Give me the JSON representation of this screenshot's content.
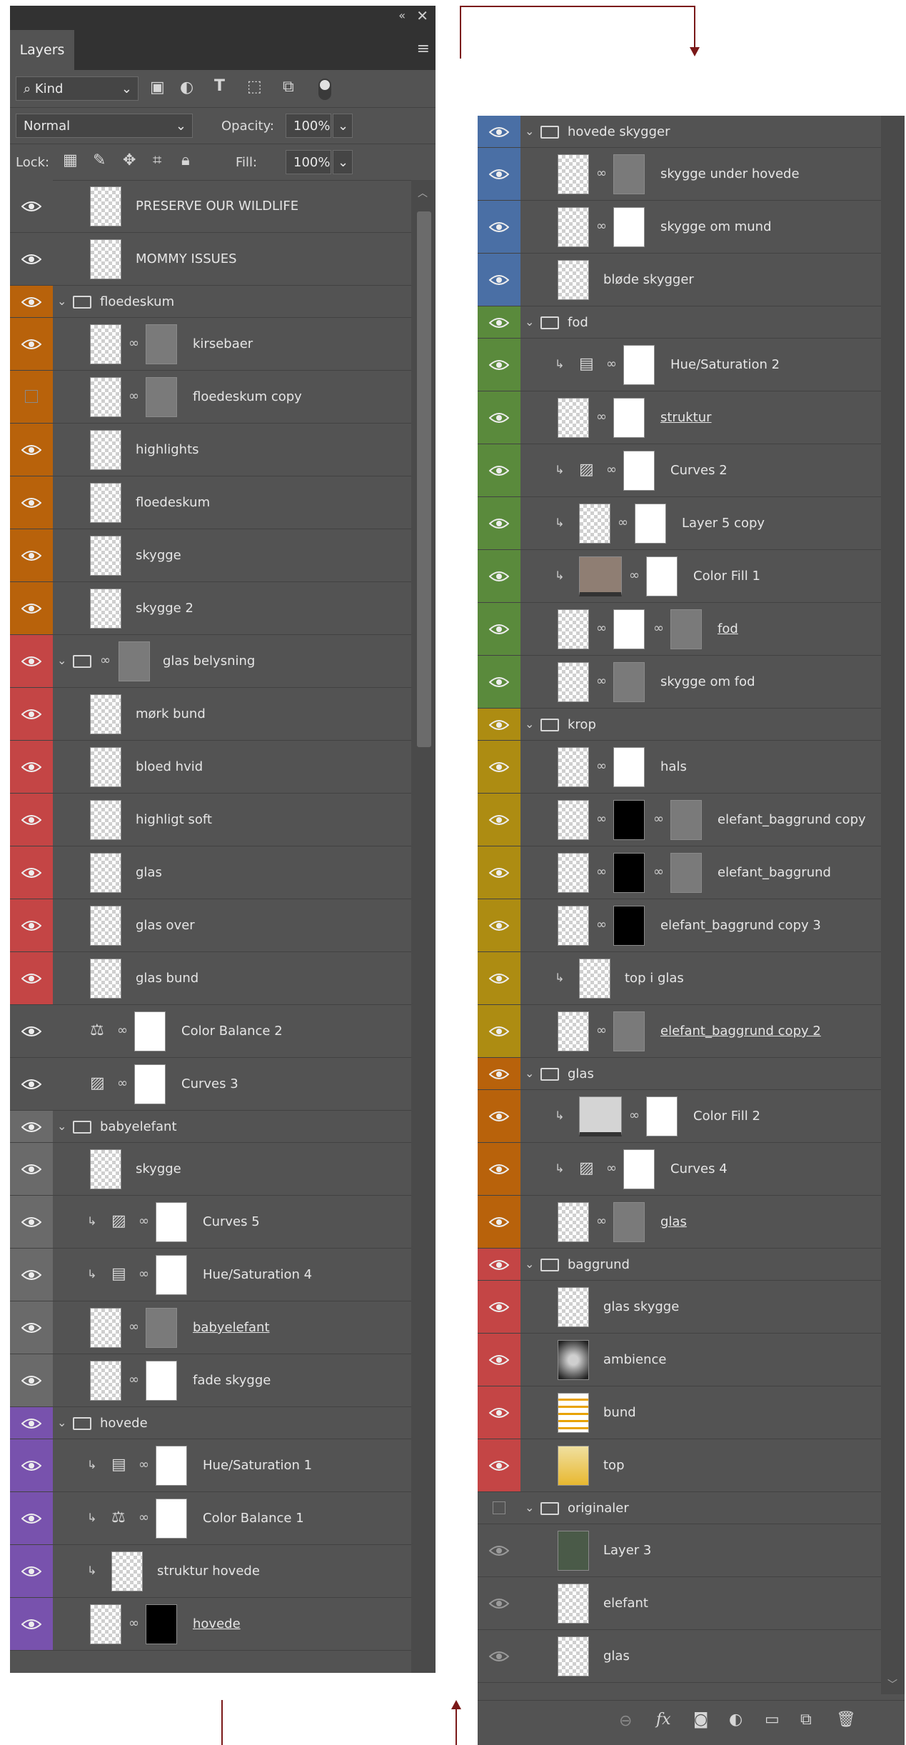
{
  "panel": {
    "tab_label": "Layers",
    "filter_kind": "Kind",
    "blend_mode": "Normal",
    "opacity_label": "Opacity:",
    "opacity_value": "100%",
    "lock_label": "Lock:",
    "fill_label": "Fill:",
    "fill_value": "100%"
  },
  "colors": {
    "orange": "#b8620b",
    "red": "#c44545",
    "gray": "#6a6a6a",
    "purple": "#7852ad",
    "blue": "#4a6fa5",
    "green": "#5a8a3c",
    "yellow": "#ad8c12",
    "none": "#535353"
  },
  "left_layers": [
    {
      "name": "PRESERVE OUR WILDLIFE",
      "type": "layer",
      "color": "none",
      "visible": true,
      "thumb": "checker"
    },
    {
      "name": "MOMMY ISSUES",
      "type": "layer",
      "color": "none",
      "visible": true,
      "thumb": "checker"
    },
    {
      "name": "floedeskum",
      "type": "group",
      "color": "orange",
      "visible": true
    },
    {
      "name": "kirsebaer",
      "type": "layer",
      "color": "orange",
      "visible": true,
      "thumb": "checker",
      "mask": "gray"
    },
    {
      "name": "floedeskum copy",
      "type": "layer",
      "color": "orange",
      "visible": false,
      "thumb": "checker",
      "mask": "gray"
    },
    {
      "name": "highlights",
      "type": "layer",
      "color": "orange",
      "visible": true,
      "thumb": "checker"
    },
    {
      "name": "floedeskum",
      "type": "layer",
      "color": "orange",
      "visible": true,
      "thumb": "checker"
    },
    {
      "name": "skygge",
      "type": "layer",
      "color": "orange",
      "visible": true,
      "thumb": "checker"
    },
    {
      "name": "skygge 2",
      "type": "layer",
      "color": "orange",
      "visible": true,
      "thumb": "checker"
    },
    {
      "name": "glas belysning",
      "type": "group",
      "color": "red",
      "visible": true,
      "mask": "gray",
      "tall": true
    },
    {
      "name": "mørk bund",
      "type": "layer",
      "color": "red",
      "visible": true,
      "thumb": "checker"
    },
    {
      "name": "bloed hvid",
      "type": "layer",
      "color": "red",
      "visible": true,
      "thumb": "checker"
    },
    {
      "name": "highligt soft",
      "type": "layer",
      "color": "red",
      "visible": true,
      "thumb": "checker"
    },
    {
      "name": "glas",
      "type": "layer",
      "color": "red",
      "visible": true,
      "thumb": "checker"
    },
    {
      "name": "glas over",
      "type": "layer",
      "color": "red",
      "visible": true,
      "thumb": "checker"
    },
    {
      "name": "glas bund",
      "type": "layer",
      "color": "red",
      "visible": true,
      "thumb": "checker"
    },
    {
      "name": "Color Balance 2",
      "type": "adjust",
      "icon": "balance",
      "color": "none",
      "visible": true,
      "mask": "white"
    },
    {
      "name": "Curves 3",
      "type": "adjust",
      "icon": "curves",
      "color": "none",
      "visible": true,
      "mask": "white"
    },
    {
      "name": "babyelefant",
      "type": "group",
      "color": "gray",
      "visible": true
    },
    {
      "name": "skygge",
      "type": "layer",
      "color": "gray",
      "visible": true,
      "thumb": "checker"
    },
    {
      "name": "Curves 5",
      "type": "adjust",
      "icon": "curves",
      "color": "gray",
      "visible": true,
      "mask": "white",
      "clip": true
    },
    {
      "name": "Hue/Saturation 4",
      "type": "adjust",
      "icon": "huesat",
      "color": "gray",
      "visible": true,
      "mask": "white",
      "clip": true
    },
    {
      "name": "babyelefant",
      "type": "layer",
      "color": "gray",
      "visible": true,
      "thumb": "checker",
      "mask": "gray",
      "smart": true
    },
    {
      "name": "fade skygge",
      "type": "layer",
      "color": "gray",
      "visible": true,
      "thumb": "checker",
      "mask": "white"
    },
    {
      "name": "hovede",
      "type": "group",
      "color": "purple",
      "visible": true
    },
    {
      "name": "Hue/Saturation 1",
      "type": "adjust",
      "icon": "huesat",
      "color": "purple",
      "visible": true,
      "mask": "white",
      "clip": true
    },
    {
      "name": "Color Balance 1",
      "type": "adjust",
      "icon": "balance",
      "color": "purple",
      "visible": true,
      "mask": "white",
      "clip": true
    },
    {
      "name": "struktur hovede",
      "type": "layer",
      "color": "purple",
      "visible": true,
      "thumb": "checker",
      "clip": true
    },
    {
      "name": "hovede",
      "type": "layer",
      "color": "purple",
      "visible": true,
      "thumb": "checker",
      "mask": "black",
      "smart": true
    }
  ],
  "right_layers": [
    {
      "name": "hovede skygger",
      "type": "group",
      "color": "blue",
      "visible": true
    },
    {
      "name": "skygge under hovede",
      "type": "layer",
      "color": "blue",
      "visible": true,
      "thumb": "checker",
      "mask": "gray"
    },
    {
      "name": "skygge om mund",
      "type": "layer",
      "color": "blue",
      "visible": true,
      "thumb": "checker",
      "mask": "white"
    },
    {
      "name": "bløde skygger",
      "type": "layer",
      "color": "blue",
      "visible": true,
      "thumb": "checker"
    },
    {
      "name": "fod",
      "type": "group",
      "color": "green",
      "visible": true
    },
    {
      "name": "Hue/Saturation 2",
      "type": "adjust",
      "icon": "huesat",
      "color": "green",
      "visible": true,
      "mask": "white",
      "clip": true
    },
    {
      "name": "struktur",
      "type": "layer",
      "color": "green",
      "visible": true,
      "thumb": "checker",
      "mask": "white",
      "smart": true
    },
    {
      "name": "Curves 2",
      "type": "adjust",
      "icon": "curves",
      "color": "green",
      "visible": true,
      "mask": "white",
      "clip": true
    },
    {
      "name": "Layer 5 copy",
      "type": "layer",
      "color": "green",
      "visible": true,
      "thumb": "checker",
      "mask": "white",
      "clip": true
    },
    {
      "name": "Color Fill 1",
      "type": "fill",
      "color": "green",
      "visible": true,
      "fillcolor": "#8f7e73",
      "mask": "white",
      "clip": true
    },
    {
      "name": "fod",
      "type": "layer",
      "color": "green",
      "visible": true,
      "thumb": "checker",
      "mask": "white",
      "mask2": "gray",
      "smart": true
    },
    {
      "name": "skygge om fod",
      "type": "layer",
      "color": "green",
      "visible": true,
      "thumb": "checker",
      "mask": "gray"
    },
    {
      "name": "krop",
      "type": "group",
      "color": "yellow",
      "visible": true
    },
    {
      "name": "hals",
      "type": "layer",
      "color": "yellow",
      "visible": true,
      "thumb": "checker",
      "mask": "white"
    },
    {
      "name": "elefant_baggrund copy",
      "type": "layer",
      "color": "yellow",
      "visible": true,
      "thumb": "checker",
      "mask": "black",
      "mask2": "gray"
    },
    {
      "name": "elefant_baggrund",
      "type": "layer",
      "color": "yellow",
      "visible": true,
      "thumb": "checker",
      "mask": "black",
      "mask2": "gray"
    },
    {
      "name": "elefant_baggrund copy 3",
      "type": "layer",
      "color": "yellow",
      "visible": true,
      "thumb": "checker",
      "mask": "black"
    },
    {
      "name": "top i glas",
      "type": "layer",
      "color": "yellow",
      "visible": true,
      "thumb": "checker",
      "clip": true
    },
    {
      "name": "elefant_baggrund copy 2",
      "type": "layer",
      "color": "yellow",
      "visible": true,
      "thumb": "checker",
      "mask": "gray",
      "smart": true
    },
    {
      "name": "glas",
      "type": "group",
      "color": "orange",
      "visible": true
    },
    {
      "name": "Color Fill 2",
      "type": "fill",
      "color": "orange",
      "visible": true,
      "fillcolor": "#d4d4d4",
      "mask": "white",
      "clip": true
    },
    {
      "name": "Curves 4",
      "type": "adjust",
      "icon": "curves",
      "color": "orange",
      "visible": true,
      "mask": "white",
      "clip": true
    },
    {
      "name": "glas",
      "type": "layer",
      "color": "orange",
      "visible": true,
      "thumb": "checker",
      "mask": "gray",
      "smart": true
    },
    {
      "name": "baggrund",
      "type": "group",
      "color": "red",
      "visible": true
    },
    {
      "name": "glas skygge",
      "type": "layer",
      "color": "red",
      "visible": true,
      "thumb": "checker"
    },
    {
      "name": "ambience",
      "type": "layer",
      "color": "red",
      "visible": true,
      "thumb": "ambience"
    },
    {
      "name": "bund",
      "type": "layer",
      "color": "red",
      "visible": true,
      "thumb": "bund"
    },
    {
      "name": "top",
      "type": "layer",
      "color": "red",
      "visible": true,
      "thumb": "top"
    },
    {
      "name": "originaler",
      "type": "group",
      "color": "none",
      "visible": false
    },
    {
      "name": "Layer 3",
      "type": "layer",
      "color": "none",
      "visible": "dim",
      "thumb": "photo"
    },
    {
      "name": "elefant",
      "type": "layer",
      "color": "none",
      "visible": "dim",
      "thumb": "checker"
    },
    {
      "name": "glas",
      "type": "layer",
      "color": "none",
      "visible": "dim",
      "thumb": "checker"
    }
  ]
}
